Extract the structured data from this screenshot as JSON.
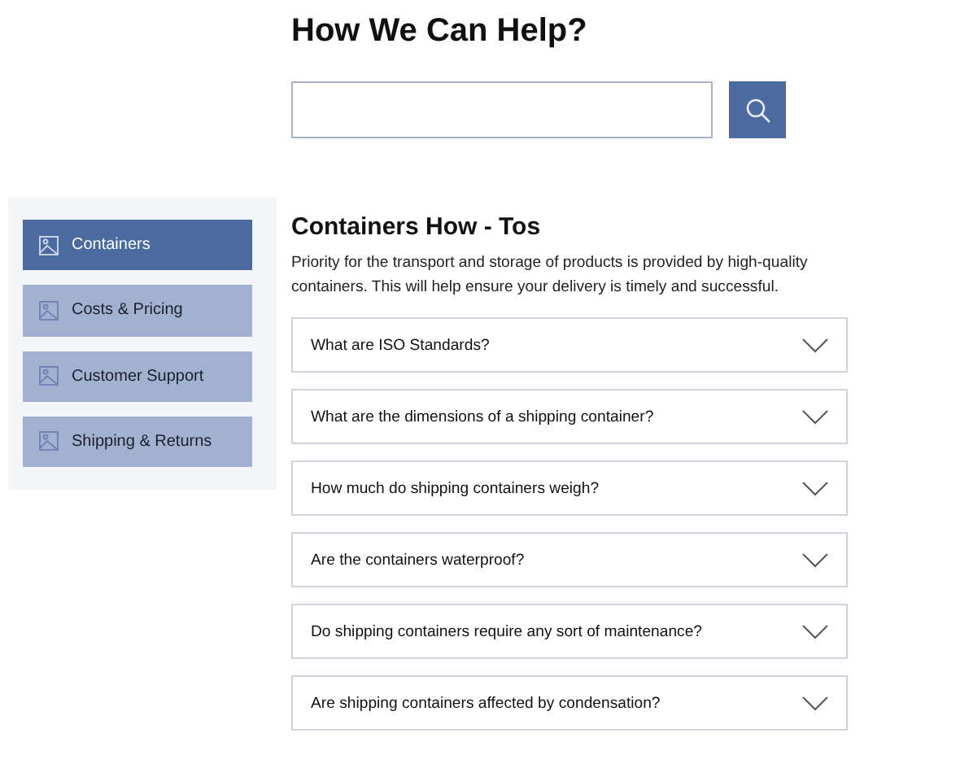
{
  "heading": "How We Can Help?",
  "sidebar": {
    "items": [
      {
        "label": "Containers",
        "selected": true
      },
      {
        "label": "Costs & Pricing",
        "selected": false
      },
      {
        "label": "Customer Support",
        "selected": false
      },
      {
        "label": "Shipping & Returns",
        "selected": false
      }
    ]
  },
  "section": {
    "title": "Containers How - Tos",
    "description": "Priority for the transport and storage of products is provided by high-quality containers. This will help ensure your delivery is timely and successful.",
    "questions": [
      {
        "text": "What are ISO Standards?",
        "expanded": false
      },
      {
        "text": "What are the dimensions of a shipping container?",
        "expanded": false
      },
      {
        "text": "How much do shipping containers weigh?",
        "expanded": false
      },
      {
        "text": "Are the containers waterproof?",
        "expanded": false
      },
      {
        "text": "Do shipping containers require any sort of maintenance?",
        "expanded": false
      },
      {
        "text": "Are shipping containers affected by condensation?",
        "expanded": false
      }
    ]
  }
}
